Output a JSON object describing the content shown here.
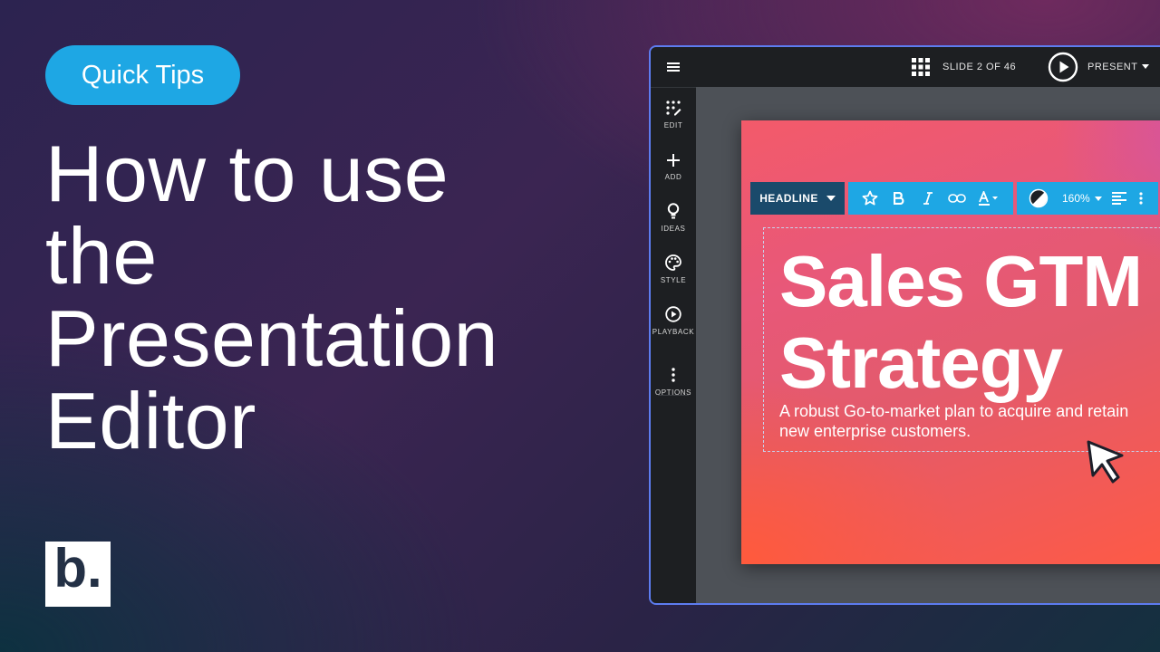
{
  "badge": "Quick Tips",
  "title_lines": [
    "How to use",
    "the",
    "Presentation",
    "Editor"
  ],
  "logo_letter": "b.",
  "editor": {
    "sidebar": [
      {
        "icon": "edit-icon",
        "label": "EDIT"
      },
      {
        "icon": "add-icon",
        "label": "ADD"
      },
      {
        "icon": "lightbulb-icon",
        "label": "IDEAS"
      },
      {
        "icon": "palette-icon",
        "label": "STYLE"
      },
      {
        "icon": "play-circle-icon",
        "label": "PLAYBACK"
      },
      {
        "icon": "more-vertical-icon",
        "label": "OPTIONS"
      }
    ],
    "slide_counter": "SLIDE 2 OF 46",
    "present_label": "PRESENT",
    "toolbar": {
      "text_style": "HEADLINE",
      "zoom": "160%"
    },
    "slide": {
      "headline_lines": [
        "Sales GTM",
        "Strategy"
      ],
      "subtitle": "A robust Go-to-market plan to acquire and retain new enterprise customers."
    }
  },
  "colors": {
    "badge": "#1ea7e4",
    "toolbar_accent": "#1ea7e4",
    "headline_dropdown": "#1a4a6b",
    "window_border": "#5d7cf0",
    "slide_gradient_start": "#ff5a44",
    "slide_gradient_end": "#c066c8"
  }
}
